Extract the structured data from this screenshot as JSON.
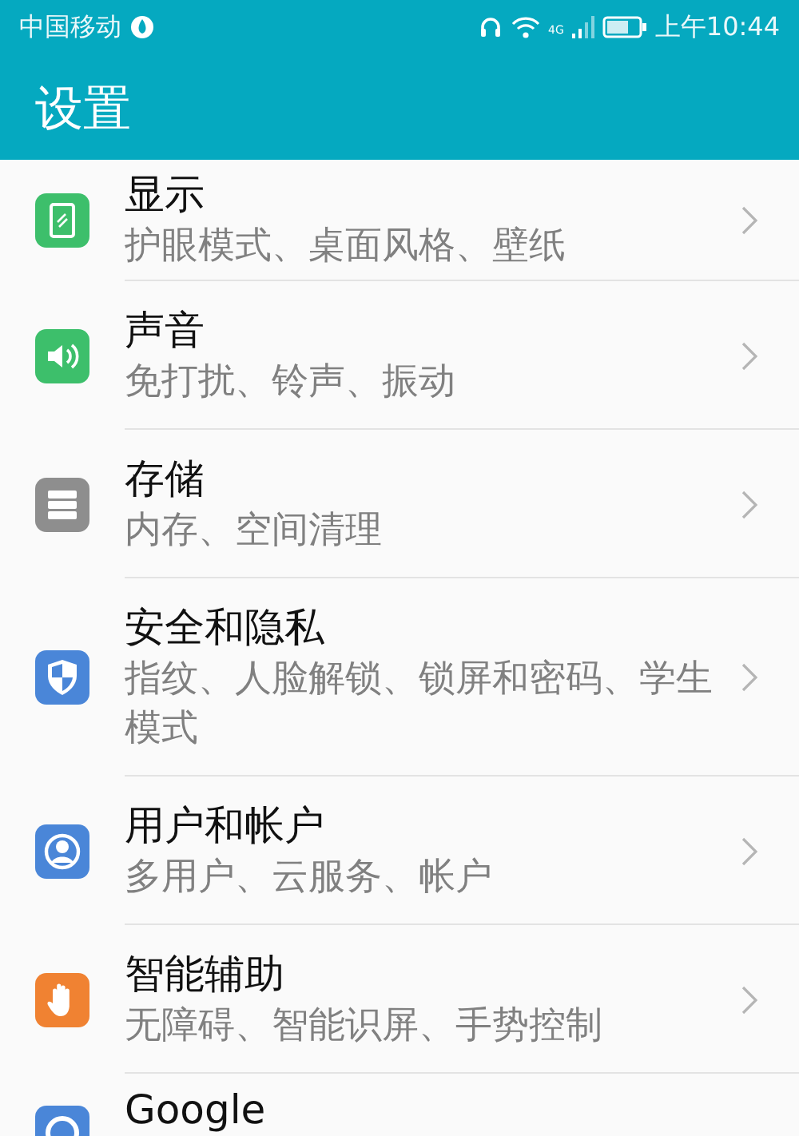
{
  "status_bar": {
    "carrier": "中国移动",
    "time": "上午10:44",
    "network": "4G"
  },
  "header": {
    "title": "设置"
  },
  "items": [
    {
      "title": "显示",
      "subtitle": "护眼模式、桌面风格、壁纸",
      "kind": "display",
      "color": "#3dbf6b"
    },
    {
      "title": "声音",
      "subtitle": "免打扰、铃声、振动",
      "kind": "sound",
      "color": "#3dbf6b"
    },
    {
      "title": "存储",
      "subtitle": "内存、空间清理",
      "kind": "storage",
      "color": "#8e8e8e"
    },
    {
      "title": "安全和隐私",
      "subtitle": "指纹、人脸解锁、锁屏和密码、学生模式",
      "kind": "security",
      "color": "#4a86d8"
    },
    {
      "title": "用户和帐户",
      "subtitle": "多用户、云服务、帐户",
      "kind": "user",
      "color": "#4a86d8"
    },
    {
      "title": "智能辅助",
      "subtitle": "无障碍、智能识屏、手势控制",
      "kind": "hand",
      "color": "#f08232"
    },
    {
      "title": "Google",
      "kind": "google",
      "color": "#4a86d8"
    }
  ]
}
